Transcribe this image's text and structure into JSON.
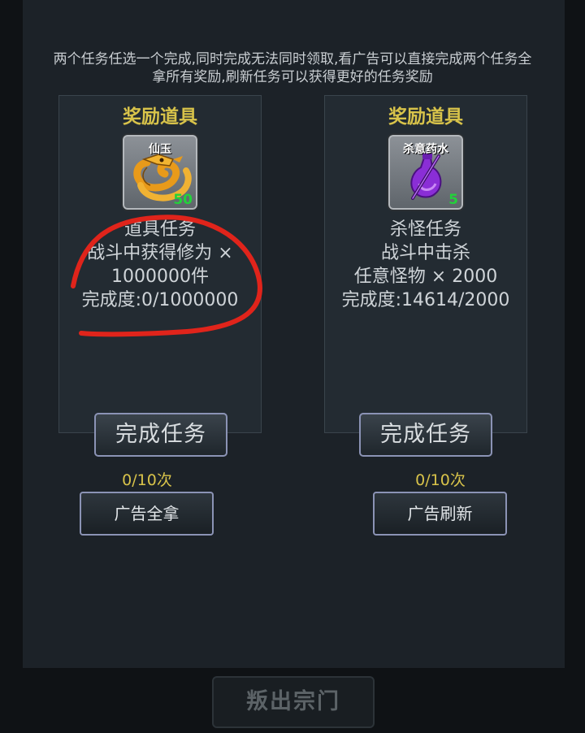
{
  "description": "两个任务任选一个完成,同时完成无法同时领取,看广告可以直接完成两个任务全拿所有奖励,刷新任务可以获得更好的任务奖励",
  "cards": [
    {
      "title": "奖励道具",
      "item": {
        "name": "仙玉",
        "count": "50",
        "icon": "golden-dragon-icon"
      },
      "lines": [
        "道具任务",
        "战斗中获得修为 ×",
        "1000000件",
        "完成度:0/1000000"
      ],
      "complete_label": "完成任务",
      "counter": "0/10次",
      "ad_label": "广告全拿"
    },
    {
      "title": "奖励道具",
      "item": {
        "name": "杀意药水",
        "count": "5",
        "icon": "purple-potion-icon"
      },
      "lines": [
        "杀怪任务",
        "战斗中击杀",
        "任意怪物 × 2000",
        "完成度:14614/2000"
      ],
      "complete_label": "完成任务",
      "counter": "0/10次",
      "ad_label": "广告刷新"
    }
  ],
  "leave_label": "叛出宗门",
  "colors": {
    "title_gold": "#d8c34a",
    "count_green": "#22d23a",
    "annotation_red": "#e0241b"
  }
}
